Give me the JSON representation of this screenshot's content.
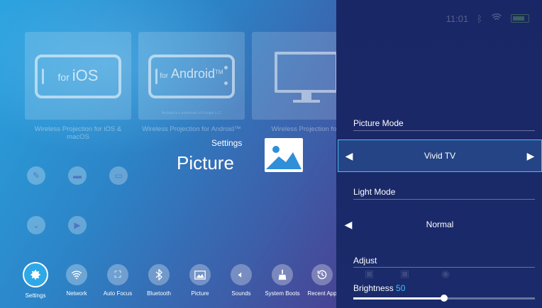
{
  "cards": [
    {
      "label_prefix": "for",
      "label_main": "iOS",
      "caption": "Wireless Projection for iOS & macOS"
    },
    {
      "label_prefix": "for",
      "label_main": "Android",
      "label_tm": "TM",
      "tiny_text": "Android is a trademark of Google LLC",
      "caption": "Wireless Projection for Android™"
    },
    {
      "caption": "Wireless Projection for"
    }
  ],
  "overlay": {
    "breadcrumb": "Settings",
    "title": "Picture"
  },
  "dock": [
    {
      "label": "Settings",
      "icon": "gear-icon",
      "active": true
    },
    {
      "label": "Network",
      "icon": "wifi-icon"
    },
    {
      "label": "Auto Focus",
      "icon": "focus-icon"
    },
    {
      "label": "Bluetooth",
      "icon": "bluetooth-icon"
    },
    {
      "label": "Picture",
      "icon": "image-icon"
    },
    {
      "label": "Sounds",
      "icon": "speaker-icon"
    },
    {
      "label": "System Boots",
      "icon": "broom-icon"
    },
    {
      "label": "Recent App",
      "icon": "history-icon"
    }
  ],
  "status": {
    "time": "11:01"
  },
  "panel": {
    "picture_mode_label": "Picture Mode",
    "picture_mode_value": "Vivid TV",
    "light_mode_label": "Light Mode",
    "light_mode_value": "Normal",
    "adjust_label": "Adjust",
    "brightness_label": "Brightness",
    "brightness_value": "50",
    "brightness_level": 0.5
  },
  "colors": {
    "accent": "#3ec3ff",
    "panel_bg": "#1a2766",
    "active_dock": "#2fa8e8"
  }
}
